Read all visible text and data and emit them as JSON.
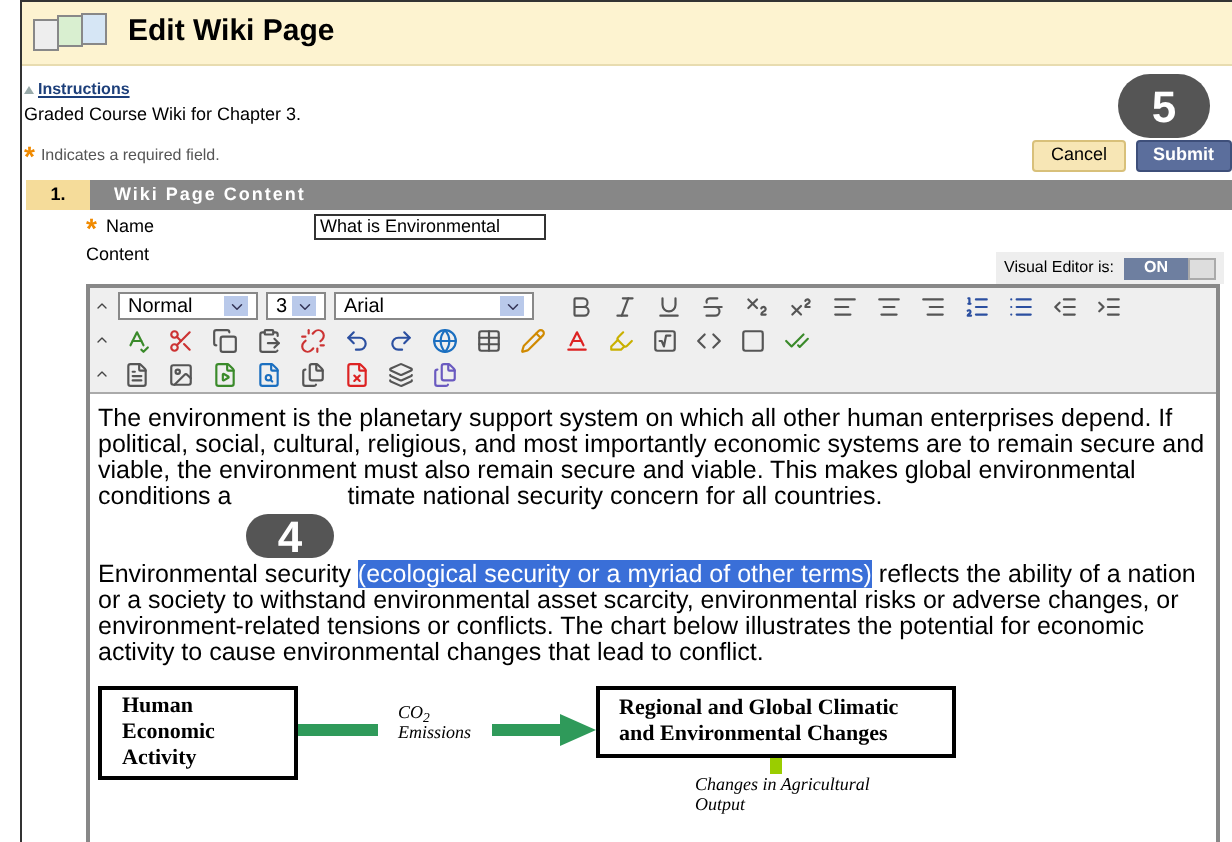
{
  "header": {
    "title": "Edit Wiki Page"
  },
  "instructions": {
    "link": "Instructions",
    "text": "Graded Course Wiki for Chapter 3.",
    "required_note": "Indicates a required field.",
    "required_mark": "*"
  },
  "step_badges": [
    {
      "label": "5"
    },
    {
      "label": "4"
    }
  ],
  "buttons": [
    {
      "label": "Cancel",
      "kind": "secondary"
    },
    {
      "label": "Submit",
      "kind": "primary"
    }
  ],
  "section": {
    "number": "1.",
    "title": "Wiki Page Content"
  },
  "name_field": {
    "label": "Name",
    "required_mark": "*",
    "value": "What is Environmental"
  },
  "content_label": "Content",
  "visual_editor": {
    "label": "Visual Editor is:",
    "state_label": "ON",
    "on": true
  },
  "toolbar": {
    "format": "Normal",
    "size": "3",
    "font": "Arial"
  },
  "paragraphs": [
    {
      "before": "The environment is the planetary support system on which all other human enterprises depend. If political, social, cultural, religious, and most importantly economic systems are to remain secure and viable, the environment must also remain secure and viable. This makes global environmental conditions a",
      "after": "timate national security concern for all countries."
    },
    {
      "before": "Environmental security ",
      "highlight": "(ecological security or a myriad of other terms)",
      "after": " reflects the ability of a nation or a society to withstand environmental asset scarcity, environmental risks or adverse changes, or environment-related tensions or conflicts. The chart below illustrates the potential for economic activity to cause environmental changes that lead to conflict."
    }
  ],
  "diagram": {
    "left_box": "Human Economic Activity",
    "arrow_label": "CO$_{2}$ Emissions",
    "right_box": "Regional and Global Climatic and Environmental Changes",
    "bottom_label": "Changes in Agricultural Output"
  }
}
